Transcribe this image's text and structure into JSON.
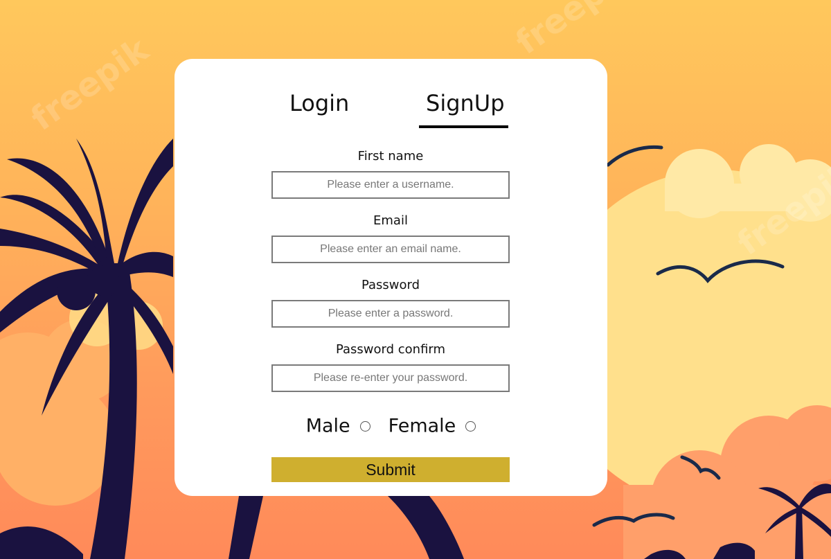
{
  "tabs": {
    "login": "Login",
    "signup": "SignUp",
    "active": "SignUp"
  },
  "form": {
    "fields": [
      {
        "label": "First name",
        "placeholder": "Please enter a username.",
        "value": ""
      },
      {
        "label": "Email",
        "placeholder": "Please enter an email name.",
        "value": ""
      },
      {
        "label": "Password",
        "placeholder": "Please enter a password.",
        "value": ""
      },
      {
        "label": "Password confirm",
        "placeholder": "Please re-enter your password.",
        "value": ""
      }
    ],
    "gender": {
      "male": "Male",
      "female": "Female"
    },
    "submit": "Submit"
  },
  "watermark": "freepik",
  "colors": {
    "submit": "#cfaf2f",
    "card": "#ffffff",
    "sky_top": "#ffc85c",
    "sky_bottom": "#ff8a5a",
    "silhouette": "#1a1240",
    "sun": "#ffe18a"
  }
}
